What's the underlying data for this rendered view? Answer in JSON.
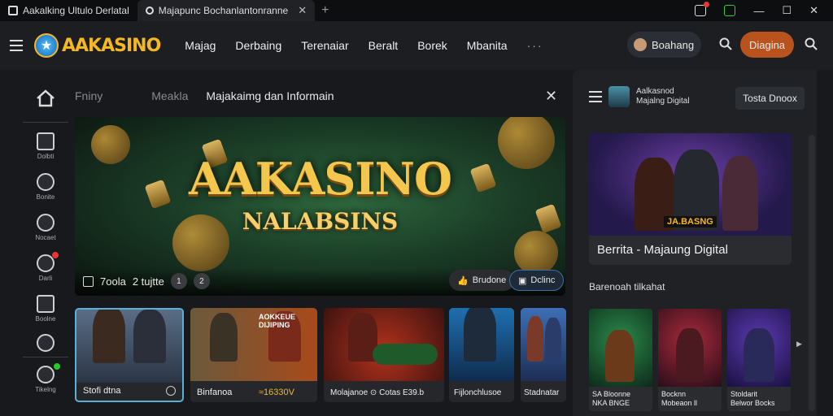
{
  "browser": {
    "tabs": [
      {
        "label": "Aakalking Ultulo Derlatal"
      },
      {
        "label": "Majapunc Bochanlantonranne"
      }
    ],
    "new_tab": "+",
    "controls": {
      "minimize": "—",
      "maximize": "☐",
      "close": "✕"
    }
  },
  "header": {
    "logo_text": "AAKASINO",
    "nav": [
      "Majag",
      "Derbaing",
      "Terenaiar",
      "Beralt",
      "Borek",
      "Mbanita"
    ],
    "nav_more": "···",
    "user_label": "Boahang",
    "cta_label": "Diagina"
  },
  "sidebar": {
    "items": [
      {
        "label": "Dolbti",
        "icon": "shield-icon"
      },
      {
        "label": "Bonite",
        "icon": "gear-icon"
      },
      {
        "label": "Nocaet",
        "icon": "search-icon"
      },
      {
        "label": "Darli",
        "icon": "chip-icon"
      },
      {
        "label": "Boolne",
        "icon": "home-icon"
      },
      {
        "label": "Tikelng",
        "icon": "help-icon"
      }
    ]
  },
  "main": {
    "breadcrumbs": [
      "Fniny",
      "Meakla",
      "Majakaimg dan Informain"
    ],
    "banner": {
      "title": "AAKASINO",
      "subtitle": "NALABSINS",
      "footer_label": "7oola",
      "footer_sub": "2 tujtte",
      "footer_num1": "1",
      "footer_num2": "2",
      "pill_a": "Brudone",
      "pill_b": "Dclinc"
    },
    "thumbnails": [
      {
        "caption": "Stofi dtna"
      },
      {
        "caption": "Binfanoa"
      },
      {
        "caption": "≈16330V"
      },
      {
        "caption": "Molajanoe ⊙ Cotas E39.b"
      },
      {
        "caption": "Fijlonchlusoe"
      },
      {
        "caption": "Stadnatar"
      }
    ],
    "banner_tags": [
      "AOKKEUE",
      "DIJIPING"
    ]
  },
  "right_panel": {
    "title_line1": "Aalkasnod",
    "title_line2": "Majalng Digital",
    "button": "Tosta Dnoox",
    "featured": {
      "title": "Berrita - Majaung Digital",
      "tag": "JA.BASNG"
    },
    "section": "Barenoah tilkahat",
    "mini": [
      {
        "line1": "SA Bloonne",
        "line2": "NKA BNGE"
      },
      {
        "line1": "Bocknn",
        "line2": "Mobeaon ll"
      },
      {
        "line1": "Stoldarit",
        "line2": "Belwor Bocks"
      }
    ]
  },
  "colors": {
    "accent": "#b8531e",
    "gold": "#f5b820",
    "bg": "#17191d"
  }
}
